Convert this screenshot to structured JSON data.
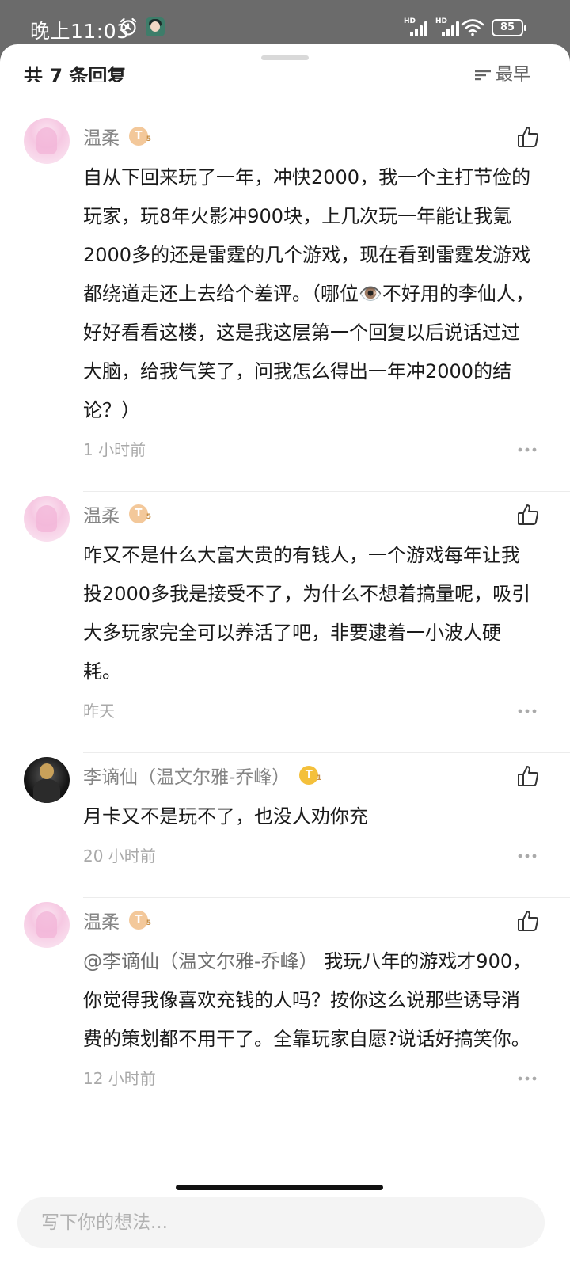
{
  "status_bar": {
    "time": "晚上11:03",
    "battery": "85",
    "signal_label_1": "HD",
    "signal_label_2": "HD"
  },
  "header": {
    "title": "共 7 条回复",
    "sort_label": "最早"
  },
  "comments": [
    {
      "username": "温柔",
      "badge": "T",
      "badge_level": "5",
      "text": "自从下回来玩了一年，冲快2000，我一个主打节俭的玩家，玩8年火影冲900块，上几次玩一年能让我氪2000多的还是雷霆的几个游戏，现在看到雷霆发游戏都绕道走还上去给个差评。（哪位👁️不好用的李仙人，好好看看这楼，这是我这层第一个回复以后说话过过大脑，给我气笑了，问我怎么得出一年冲2000的结论？）",
      "time": "1 小时前"
    },
    {
      "username": "温柔",
      "badge": "T",
      "badge_level": "5",
      "text": "咋又不是什么大富大贵的有钱人，一个游戏每年让我投2000多我是接受不了，为什么不想着搞量呢，吸引大多玩家完全可以养活了吧，非要逮着一小波人硬耗。",
      "time": "昨天"
    },
    {
      "username": "李谪仙（温文尔雅-乔峰）",
      "badge": "T",
      "badge_level": "1",
      "text": "月卡又不是玩不了，也没人劝你充",
      "time": "20 小时前"
    },
    {
      "username": "温柔",
      "badge": "T",
      "badge_level": "5",
      "mention": "@李谪仙（温文尔雅-乔峰）",
      "text": "  我玩八年的游戏才900，你觉得我像喜欢充钱的人吗？按你这么说那些诱导消费的策划都不用干了。全靠玩家自愿?说话好搞笑你。",
      "time": "12 小时前"
    }
  ],
  "input": {
    "placeholder": "写下你的想法..."
  },
  "colors": {
    "username": "#858585",
    "meta": "#a9a9a9",
    "badge": "#f3c89a",
    "badge_gold": "#f4c03b"
  },
  "icons": [
    "alarm-icon",
    "wifi-icon",
    "like-icon",
    "more-icon",
    "sort-icon"
  ]
}
